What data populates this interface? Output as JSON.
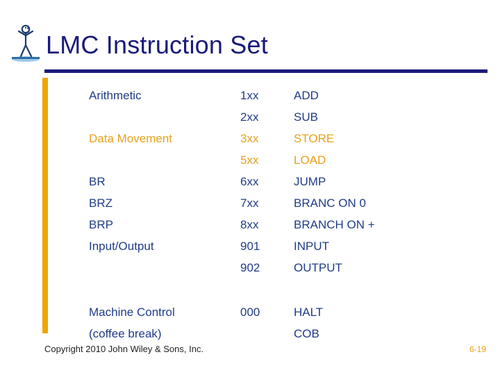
{
  "slide": {
    "title": "LMC Instruction Set",
    "logo_icon": "wiley-figure-logo-icon"
  },
  "colors": {
    "title_navy": "#1a1a7a",
    "body_navy": "#1f3c88",
    "gold": "#e8a11c",
    "accent_bar": "#f0a500"
  },
  "table": {
    "rows": [
      {
        "mnemonic": "Arithmetic",
        "mnemonic_color": "navy",
        "code": "1xx",
        "code_color": "navy",
        "op": "ADD",
        "op_color": "navy"
      },
      {
        "mnemonic": "",
        "mnemonic_color": "navy",
        "code": "2xx",
        "code_color": "navy",
        "op": "SUB",
        "op_color": "navy"
      },
      {
        "mnemonic": "Data Movement",
        "mnemonic_color": "gold",
        "code": "3xx",
        "code_color": "gold",
        "op": "STORE",
        "op_color": "gold"
      },
      {
        "mnemonic": "",
        "mnemonic_color": "gold",
        "code": "5xx",
        "code_color": "gold",
        "op": "LOAD",
        "op_color": "gold"
      },
      {
        "mnemonic": "BR",
        "mnemonic_color": "navy",
        "code": "6xx",
        "code_color": "navy",
        "op": "JUMP",
        "op_color": "navy"
      },
      {
        "mnemonic": "BRZ",
        "mnemonic_color": "navy",
        "code": "7xx",
        "code_color": "navy",
        "op": "BRANC ON 0",
        "op_color": "navy"
      },
      {
        "mnemonic": "BRP",
        "mnemonic_color": "navy",
        "code": "8xx",
        "code_color": "navy",
        "op": "BRANCH ON +",
        "op_color": "navy"
      },
      {
        "mnemonic": "Input/Output",
        "mnemonic_color": "navy",
        "code": "901",
        "code_color": "navy",
        "op": "INPUT",
        "op_color": "navy"
      },
      {
        "mnemonic": "",
        "mnemonic_color": "navy",
        "code": "902",
        "code_color": "navy",
        "op": "OUTPUT",
        "op_color": "navy"
      }
    ],
    "final_rows": [
      {
        "mnemonic": "Machine Control",
        "mnemonic_color": "navy",
        "code": "000",
        "code_color": "navy",
        "op": "HALT",
        "op_color": "navy"
      },
      {
        "mnemonic": "(coffee break)",
        "mnemonic_color": "navy",
        "code": "",
        "code_color": "navy",
        "op": "COB",
        "op_color": "navy"
      }
    ]
  },
  "footer": {
    "copyright": "Copyright 2010 John Wiley & Sons, Inc.",
    "page": "6-19"
  }
}
